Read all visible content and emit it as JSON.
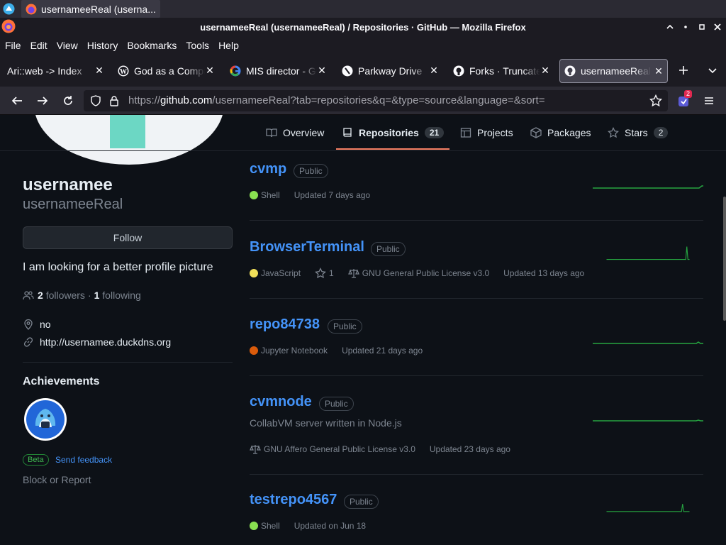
{
  "taskbar": {
    "window_title": "usernameeReal (userna..."
  },
  "window": {
    "title": "usernameeReal (usernameeReal) / Repositories · GitHub — Mozilla Firefox"
  },
  "menu": {
    "items": [
      "File",
      "Edit",
      "View",
      "History",
      "Bookmarks",
      "Tools",
      "Help"
    ]
  },
  "tabs": [
    {
      "title": "Ari::web -> Index",
      "favicon": "none",
      "active": false
    },
    {
      "title": "God as a Computer",
      "favicon": "wordpress-icon",
      "active": false
    },
    {
      "title": "MIS director - Google",
      "favicon": "google-icon",
      "active": false
    },
    {
      "title": "Parkway Drive",
      "favicon": "site-icon",
      "active": false
    },
    {
      "title": "Forks · Truncate",
      "favicon": "github-icon",
      "active": false
    },
    {
      "title": "usernameeReal (usernameeReal)",
      "favicon": "github-icon",
      "active": true
    }
  ],
  "navbar": {
    "url_prefix": "https://",
    "url_host": "github.com",
    "url_rest": "/usernameeReal?tab=repositories&q=&type=source&language=&sort=",
    "extension_badge": "2"
  },
  "profile_tabs": [
    {
      "label": "Overview",
      "icon": "book-icon",
      "counter": ""
    },
    {
      "label": "Repositories",
      "icon": "repo-icon",
      "counter": "21",
      "selected": true
    },
    {
      "label": "Projects",
      "icon": "table-icon",
      "counter": ""
    },
    {
      "label": "Packages",
      "icon": "package-icon",
      "counter": ""
    },
    {
      "label": "Stars",
      "icon": "star-icon",
      "counter": "2"
    }
  ],
  "profile": {
    "name": "usernamee",
    "login": "usernameeReal",
    "follow_label": "Follow",
    "bio": "I am looking for a better profile picture",
    "followers_count": "2",
    "followers_label": "followers",
    "separator": "·",
    "following_count": "1",
    "following_label": "following",
    "location": "no",
    "website": "http://usernamee.duckdns.org",
    "achievements_title": "Achievements",
    "beta_label": "Beta",
    "feedback_label": "Send feedback",
    "block_label": "Block or Report"
  },
  "repos": [
    {
      "name": "cvmp",
      "visibility": "Public",
      "description": "",
      "language": "Shell",
      "lang_color": "#89e051",
      "stars": "",
      "license": "",
      "updated": "Updated 7 days ago"
    },
    {
      "name": "BrowserTerminal",
      "visibility": "Public",
      "description": "",
      "language": "JavaScript",
      "lang_color": "#f1e05a",
      "stars": "1",
      "license": "GNU General Public License v3.0",
      "updated": "Updated 13 days ago"
    },
    {
      "name": "repo84738",
      "visibility": "Public",
      "description": "",
      "language": "Jupyter Notebook",
      "lang_color": "#da5b0b",
      "stars": "",
      "license": "",
      "updated": "Updated 21 days ago"
    },
    {
      "name": "cvmnode",
      "visibility": "Public",
      "description": "CollabVM server written in Node.js",
      "language": "",
      "lang_color": "",
      "stars": "",
      "license": "GNU Affero General Public License v3.0",
      "updated": "Updated 23 days ago"
    },
    {
      "name": "testrepo4567",
      "visibility": "Public",
      "description": "",
      "language": "Shell",
      "lang_color": "#89e051",
      "stars": "",
      "license": "",
      "updated": "Updated on Jun 18"
    }
  ]
}
